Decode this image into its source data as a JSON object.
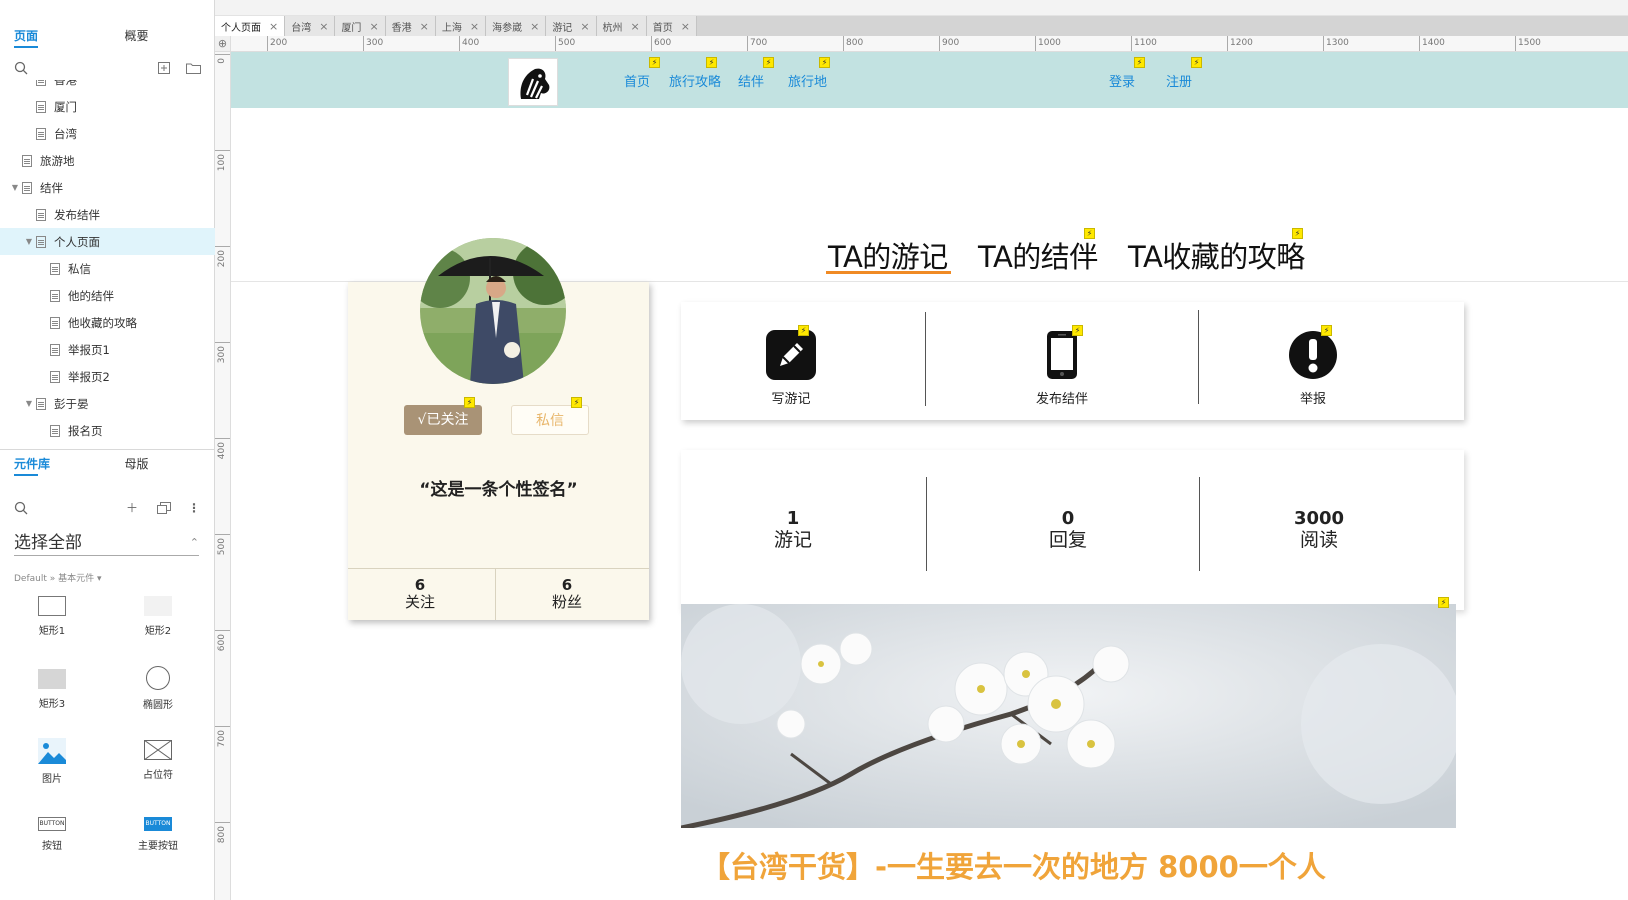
{
  "pages_panel": {
    "tabs": [
      "页面",
      "概要"
    ],
    "tree": [
      {
        "label": "香港",
        "level": 2,
        "arrow": ""
      },
      {
        "label": "厦门",
        "level": 2,
        "arrow": ""
      },
      {
        "label": "台湾",
        "level": 2,
        "arrow": ""
      },
      {
        "label": "旅游地",
        "level": 1,
        "arrow": ""
      },
      {
        "label": "结伴",
        "level": 1,
        "arrow": "▼"
      },
      {
        "label": "发布结伴",
        "level": 2,
        "arrow": ""
      },
      {
        "label": "个人页面",
        "level": 2,
        "arrow": "▼",
        "selected": true
      },
      {
        "label": "私信",
        "level": 3,
        "arrow": ""
      },
      {
        "label": "他的结伴",
        "level": 3,
        "arrow": ""
      },
      {
        "label": "他收藏的攻略",
        "level": 3,
        "arrow": ""
      },
      {
        "label": "举报页1",
        "level": 3,
        "arrow": ""
      },
      {
        "label": "举报页2",
        "level": 3,
        "arrow": ""
      },
      {
        "label": "彭于晏",
        "level": 2,
        "arrow": "▼"
      },
      {
        "label": "报名页",
        "level": 3,
        "arrow": ""
      }
    ]
  },
  "library_panel": {
    "tabs": [
      "元件库",
      "母版"
    ],
    "select_value": "选择全部",
    "breadcrumb": "Default » 基本元件 ▾",
    "widgets": [
      "矩形1",
      "矩形2",
      "矩形3",
      "椭圆形",
      "图片",
      "占位符",
      "按钮",
      "主要按钮"
    ],
    "button_widget_text": "BUTTON"
  },
  "doc_tabs": [
    "个人页面",
    "台湾",
    "厦门",
    "香港",
    "上海",
    "海参崴",
    "游记",
    "杭州",
    "首页"
  ],
  "ruler": {
    "h_labels": [
      "200",
      "300",
      "400",
      "500",
      "600",
      "700",
      "800",
      "900",
      "1000",
      "1100",
      "1200",
      "1300",
      "1400",
      "1500"
    ],
    "v_labels": [
      "0",
      "100",
      "200",
      "300",
      "400",
      "500",
      "600",
      "700",
      "800"
    ]
  },
  "header": {
    "nav": [
      "首页",
      "旅行攻略",
      "结伴",
      "旅行地"
    ],
    "auth": [
      "登录",
      "注册"
    ]
  },
  "ta_tabs": [
    "TA的游记",
    "TA的结伴",
    "TA收藏的攻略"
  ],
  "profile": {
    "follow_btn": "√已关注",
    "message_btn": "私信",
    "signature": "“这是一条个性签名”",
    "stats": [
      {
        "value": "6",
        "label": "关注"
      },
      {
        "value": "6",
        "label": "粉丝"
      }
    ]
  },
  "actions": [
    "写游记",
    "发布结伴",
    "举报"
  ],
  "big_stats": [
    {
      "value": "1",
      "label": "游记"
    },
    {
      "value": "0",
      "label": "回复"
    },
    {
      "value": "3000",
      "label": "阅读"
    }
  ],
  "article": {
    "title": "【台湾干货】-一生要去一次的地方 8000一个人"
  },
  "colors": {
    "accent_blue": "#1a8ad8",
    "header_bg": "#c2e2e1",
    "orange": "#f08a24",
    "card_bg": "#fbf8ec"
  }
}
